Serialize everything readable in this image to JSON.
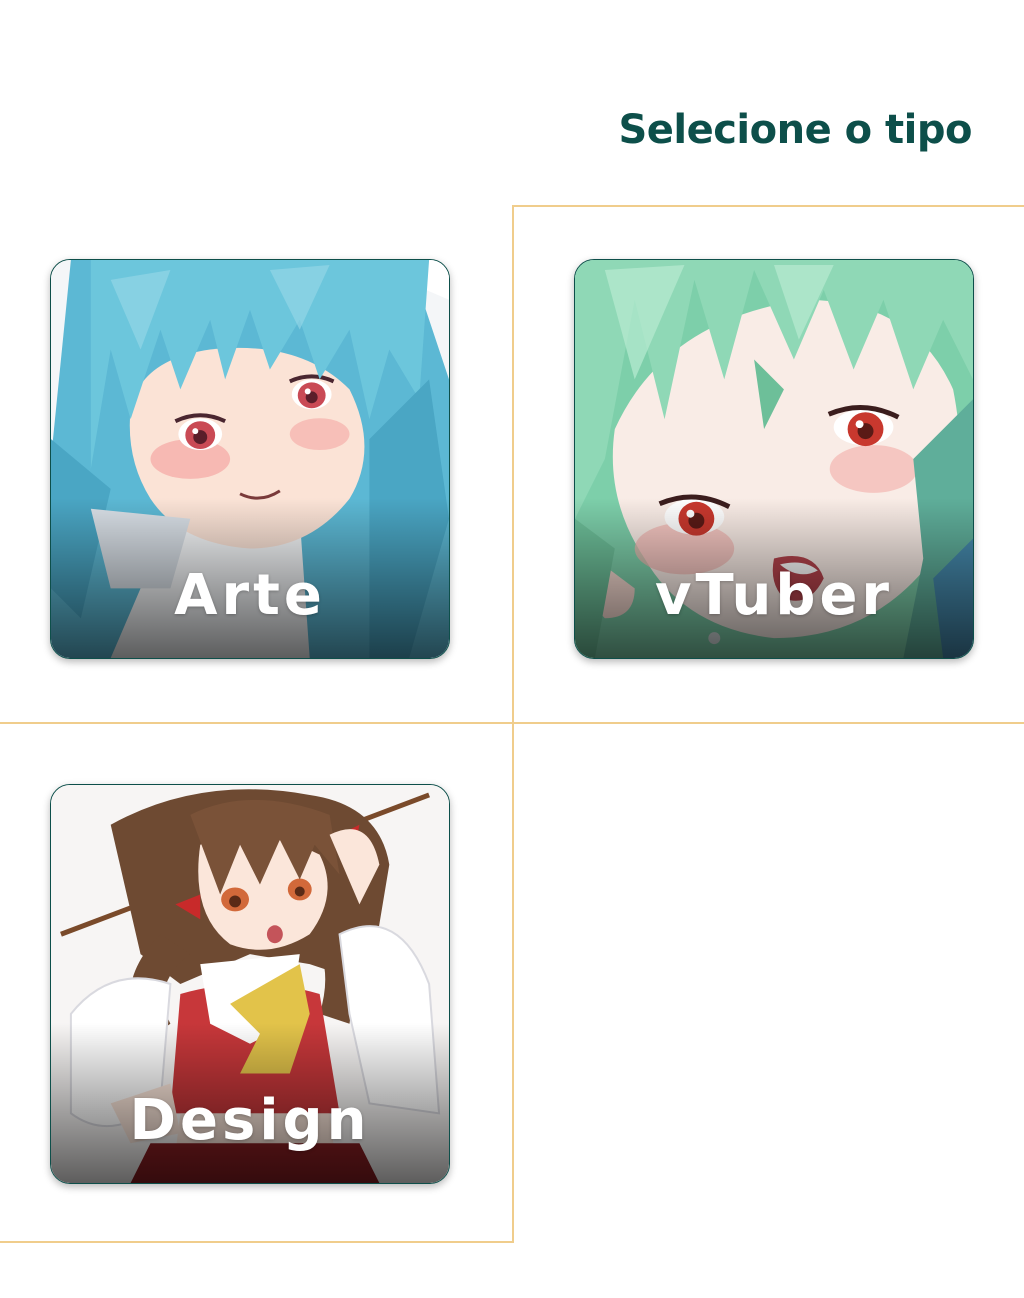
{
  "header": {
    "title": "Selecione o tipo"
  },
  "categories": [
    {
      "label": "Arte",
      "hair_color": "#6cc6dc",
      "eye_color": "#c94a55"
    },
    {
      "label": "vTuber",
      "hair_color": "#8fd8b6",
      "eye_color": "#c8382e"
    },
    {
      "label": "Design",
      "hair_color": "#6e4a32",
      "eye_color": "#d2693a"
    }
  ],
  "colors": {
    "accent": "#0d4f4a",
    "grid_line": "#f0cd8c",
    "background": "#ffffff"
  }
}
